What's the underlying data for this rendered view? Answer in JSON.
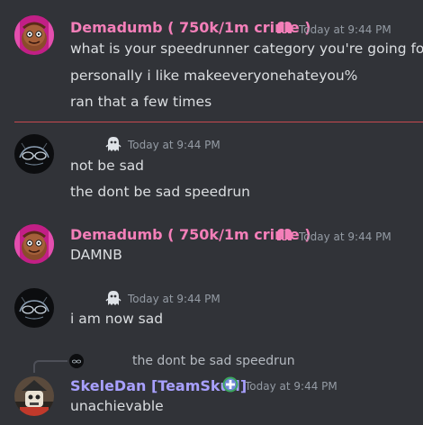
{
  "messages": [
    {
      "author": "Demadumb ( 750k/1m crime )",
      "author_color": "#f47fb9",
      "timestamp": "Today at 9:44 PM",
      "lines": [
        "what is your speedrunner category you're going for",
        "personally i like makeeveryonehateyou%",
        "ran that a few times"
      ]
    },
    {
      "author": "",
      "timestamp": "Today at 9:44 PM",
      "lines": [
        "not be sad",
        "the dont be sad speedrun"
      ]
    },
    {
      "author": "Demadumb ( 750k/1m crime )",
      "author_color": "#f47fb9",
      "timestamp": "Today at 9:44 PM",
      "lines": [
        "DAMNB"
      ]
    },
    {
      "author": "",
      "timestamp": "Today at 9:44 PM",
      "lines": [
        "i am now sad"
      ]
    },
    {
      "reply_preview": "the dont be sad speedrun",
      "author": "SkeleDan [TeamSkull]",
      "author_color": "#a8a0ff",
      "timestamp": "Today at 9:44 PM",
      "lines": [
        "unachievable"
      ]
    }
  ],
  "colors": {
    "background": "#313338",
    "text": "#dbdee1",
    "muted": "#949ba4",
    "new_divider": "#c7494f"
  },
  "icons": {
    "role_icon_pink": "brain-icon",
    "role_icon_ghost": "ghost-icon",
    "role_icon_skull": "cross-badge-icon"
  }
}
